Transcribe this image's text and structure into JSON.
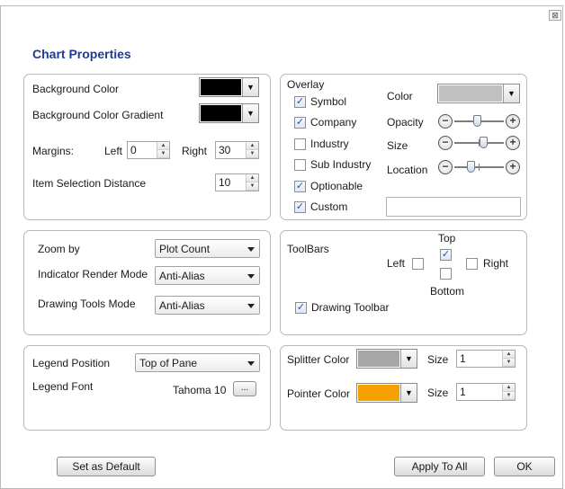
{
  "dialog": {
    "title": "Chart Properties",
    "close_glyph": "⊠"
  },
  "general": {
    "background_color_label": "Background Color",
    "background_color": "#000000",
    "background_gradient_label": "Background Color Gradient",
    "background_gradient_color": "#000000",
    "margins_label": "Margins:",
    "left_label": "Left",
    "left_value": "0",
    "right_label": "Right",
    "right_value": "30",
    "item_selection_label": "Item Selection Distance",
    "item_selection_value": "10"
  },
  "overlay": {
    "title": "Overlay",
    "items": [
      {
        "label": "Symbol",
        "checked": true
      },
      {
        "label": "Company",
        "checked": true
      },
      {
        "label": "Industry",
        "checked": false
      },
      {
        "label": "Sub Industry",
        "checked": false
      },
      {
        "label": "Optionable",
        "checked": true
      },
      {
        "label": "Custom",
        "checked": true
      }
    ],
    "color_label": "Color",
    "color_value": "#c0c0c0",
    "opacity_label": "Opacity",
    "opacity_level": 0.45,
    "size_label": "Size",
    "size_level": 0.6,
    "location_label": "Location",
    "location_level": 0.3,
    "custom_text": ""
  },
  "zoom": {
    "zoom_by_label": "Zoom by",
    "zoom_by_value": "Plot Count",
    "indicator_mode_label": "Indicator Render Mode",
    "indicator_mode_value": "Anti-Alias",
    "drawing_tools_mode_label": "Drawing Tools Mode",
    "drawing_tools_mode_value": "Anti-Alias"
  },
  "toolbars": {
    "title": "ToolBars",
    "top_label": "Top",
    "top_checked": true,
    "left_label": "Left",
    "left_checked": false,
    "right_label": "Right",
    "right_checked": false,
    "bottom_label": "Bottom",
    "bottom_checked": false,
    "drawing_toolbar_label": "Drawing Toolbar",
    "drawing_toolbar_checked": true
  },
  "legend": {
    "position_label": "Legend Position",
    "position_value": "Top of Pane",
    "font_label": "Legend Font",
    "font_value": "Tahoma 10",
    "font_button": "..."
  },
  "splitter": {
    "splitter_color_label": "Splitter Color",
    "splitter_color": "#a6a6a6",
    "splitter_size_label": "Size",
    "splitter_size_value": "1",
    "pointer_color_label": "Pointer Color",
    "pointer_color": "#f5a200",
    "pointer_size_label": "Size",
    "pointer_size_value": "1"
  },
  "buttons": {
    "set_default": "Set as Default",
    "apply_all": "Apply To All",
    "ok": "OK"
  },
  "check_glyph": "✓"
}
